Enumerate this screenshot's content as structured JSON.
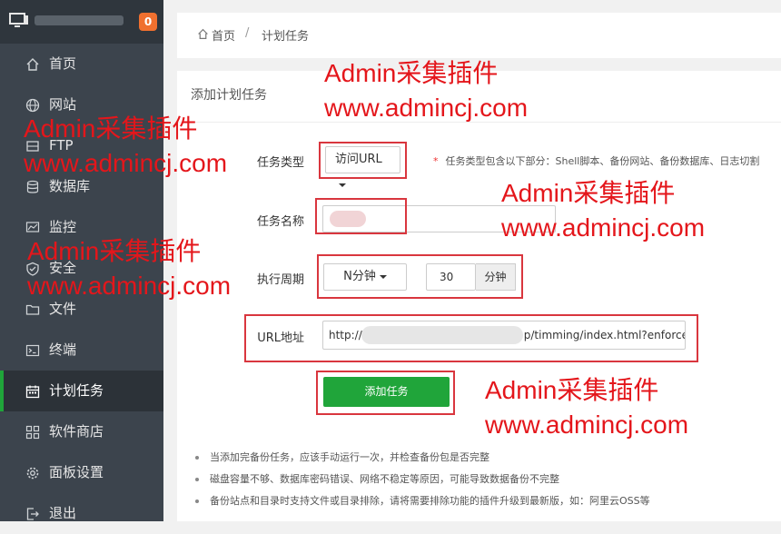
{
  "sidebar": {
    "badge_count": "0",
    "items": [
      {
        "label": "首页",
        "icon": "home-icon"
      },
      {
        "label": "网站",
        "icon": "globe-icon"
      },
      {
        "label": "FTP",
        "icon": "ftp-icon"
      },
      {
        "label": "数据库",
        "icon": "database-icon"
      },
      {
        "label": "监控",
        "icon": "monitor-chart-icon"
      },
      {
        "label": "安全",
        "icon": "shield-icon"
      },
      {
        "label": "文件",
        "icon": "folder-icon"
      },
      {
        "label": "终端",
        "icon": "terminal-icon"
      },
      {
        "label": "计划任务",
        "icon": "calendar-icon",
        "active": true
      },
      {
        "label": "软件商店",
        "icon": "apps-grid-icon"
      },
      {
        "label": "面板设置",
        "icon": "gear-icon"
      },
      {
        "label": "退出",
        "icon": "logout-icon"
      }
    ]
  },
  "breadcrumb": {
    "home": "首页",
    "separator": "/",
    "current": "计划任务"
  },
  "form": {
    "title": "添加计划任务",
    "task_type": {
      "label": "任务类型",
      "value": "访问URL",
      "hint_star": "*",
      "hint": "任务类型包含以下部分：Shell脚本、备份网站、备份数据库、日志切割"
    },
    "task_name": {
      "label": "任务名称",
      "value": ""
    },
    "period": {
      "label": "执行周期",
      "unit_select": "N分钟",
      "value": "30",
      "addon": "分钟"
    },
    "url": {
      "label": "URL地址",
      "prefix": "http://",
      "suffix": "p/timming/index.html?enforce="
    },
    "submit_label": "添加任务"
  },
  "notes": [
    "当添加完备份任务，应该手动运行一次，并检查备份包是否完整",
    "磁盘容量不够、数据库密码错误、网络不稳定等原因，可能导致数据备份不完整",
    "备份站点和目录时支持文件或目录排除，请将需要排除功能的插件升级到最新版，如：阿里云OSS等"
  ],
  "watermarks": [
    {
      "line1": "Admin采集插件",
      "line2": "www.admincj.com"
    },
    {
      "line1": "Admin采集插件",
      "line2": "www.admincj.com"
    },
    {
      "line1": "Admin采集插件",
      "line2": "www.admincj.com"
    },
    {
      "line1": "Admin采集插件",
      "line2": "www.admincj.com"
    },
    {
      "line1": "Admin采集插件",
      "line2": "www.admincj.com"
    }
  ],
  "colors": {
    "sidebar_bg": "#3c444d",
    "accent_green": "#20a53a",
    "badge_orange": "#f0702f",
    "highlight_red": "#d9363e"
  }
}
